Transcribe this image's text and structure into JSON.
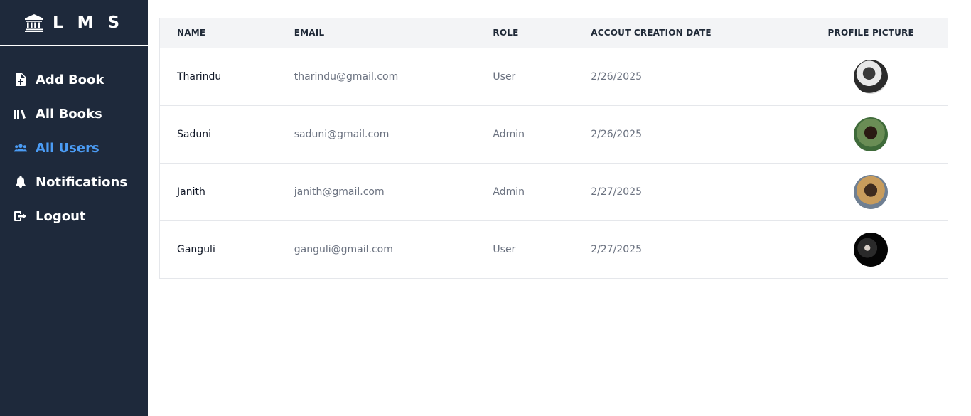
{
  "app": {
    "title": "L M S"
  },
  "sidebar": {
    "items": [
      {
        "label": "Add Book",
        "icon": "file-plus-icon",
        "active": false
      },
      {
        "label": "All Books",
        "icon": "books-icon",
        "active": false
      },
      {
        "label": "All Users",
        "icon": "users-icon",
        "active": true
      },
      {
        "label": "Notifications",
        "icon": "bell-icon",
        "active": false
      },
      {
        "label": "Logout",
        "icon": "logout-icon",
        "active": false
      }
    ]
  },
  "table": {
    "headers": [
      "NAME",
      "EMAIL",
      "ROLE",
      "ACCOUT CREATION DATE",
      "PROFILE PICTURE"
    ],
    "rows": [
      {
        "name": "Tharindu",
        "email": "tharindu@gmail.com",
        "role": "User",
        "date": "2/26/2025"
      },
      {
        "name": "Saduni",
        "email": "saduni@gmail.com",
        "role": "Admin",
        "date": "2/26/2025"
      },
      {
        "name": "Janith",
        "email": "janith@gmail.com",
        "role": "Admin",
        "date": "2/27/2025"
      },
      {
        "name": "Ganguli",
        "email": "ganguli@gmail.com",
        "role": "User",
        "date": "2/27/2025"
      }
    ]
  },
  "colors": {
    "sidebar_bg": "#1e293b",
    "accent": "#4b9cf5",
    "header_bg": "#f3f4f6"
  }
}
